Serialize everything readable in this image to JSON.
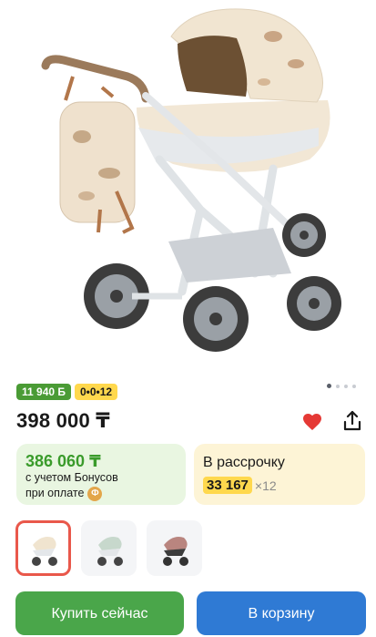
{
  "product": {
    "image_alt": "stroller-main-photo",
    "badges": {
      "bonus": "11 940 Б",
      "installment": "0•0•12"
    },
    "price": "398 000 ₸",
    "bonus_card": {
      "price": "386 060 ₸",
      "line1": "с учетом Бонусов",
      "line2": "при оплате",
      "chip": "Ф"
    },
    "installment_card": {
      "title": "В рассрочку",
      "amount": "33 167",
      "multiplier": "×12"
    },
    "gallery": {
      "total": 4,
      "active": 1
    },
    "thumbnails": [
      {
        "name": "thumb-beige",
        "selected": true
      },
      {
        "name": "thumb-mint",
        "selected": false
      },
      {
        "name": "thumb-pink",
        "selected": false
      }
    ]
  },
  "actions": {
    "buy_now": "Купить сейчас",
    "add_to_cart": "В корзину"
  },
  "icons": {
    "favorite": "heart-icon",
    "share": "share-icon"
  },
  "colors": {
    "green": "#4aa64a",
    "blue": "#2f7ad4",
    "heart": "#e53935",
    "selected_border": "#e9584b"
  }
}
